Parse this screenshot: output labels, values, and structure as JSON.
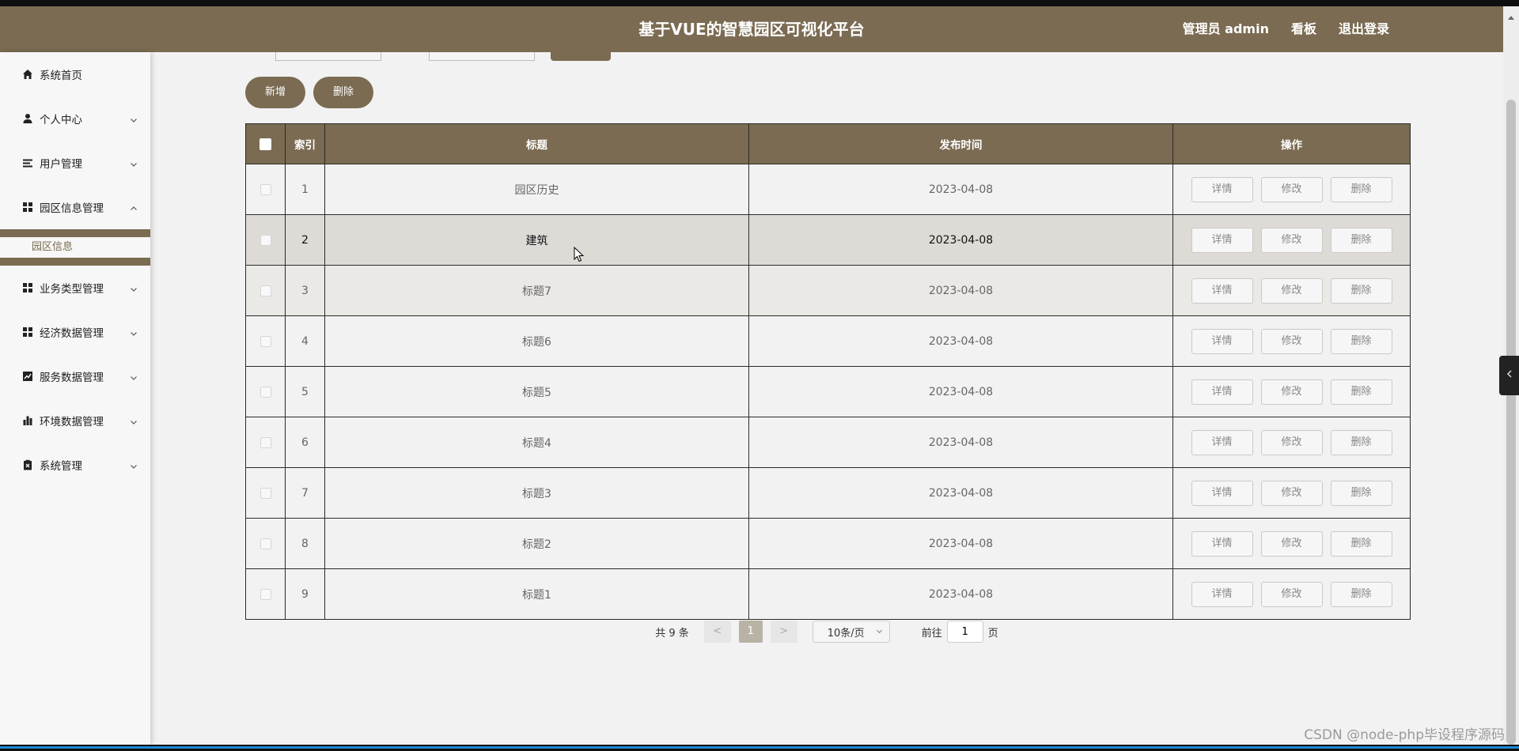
{
  "header": {
    "title": "基于VUE的智慧园区可视化平台",
    "user": "管理员 admin",
    "dashboard": "看板",
    "logout": "退出登录"
  },
  "sidebar": {
    "items": [
      {
        "label": "系统首页",
        "icon": "home-icon",
        "expandable": false
      },
      {
        "label": "个人中心",
        "icon": "user-icon",
        "expandable": true
      },
      {
        "label": "用户管理",
        "icon": "list-icon",
        "expandable": true
      },
      {
        "label": "园区信息管理",
        "icon": "grid-icon",
        "expandable": true,
        "expanded": true,
        "children": [
          "园区信息"
        ]
      },
      {
        "label": "业务类型管理",
        "icon": "grid-icon",
        "expandable": true
      },
      {
        "label": "经济数据管理",
        "icon": "grid-icon",
        "expandable": true
      },
      {
        "label": "服务数据管理",
        "icon": "line-chart-icon",
        "expandable": true
      },
      {
        "label": "环境数据管理",
        "icon": "bar-chart-icon",
        "expandable": true
      },
      {
        "label": "系统管理",
        "icon": "clipboard-icon",
        "expandable": true
      }
    ]
  },
  "toolbar": {
    "add_label": "新增",
    "delete_label": "删除"
  },
  "table": {
    "columns": [
      "索引",
      "标题",
      "发布时间",
      "操作"
    ],
    "actions": [
      "详情",
      "修改",
      "删除"
    ],
    "rows": [
      {
        "index": "1",
        "title": "园区历史",
        "date": "2023-04-08"
      },
      {
        "index": "2",
        "title": "建筑",
        "date": "2023-04-08"
      },
      {
        "index": "3",
        "title": "标题7",
        "date": "2023-04-08"
      },
      {
        "index": "4",
        "title": "标题6",
        "date": "2023-04-08"
      },
      {
        "index": "5",
        "title": "标题5",
        "date": "2023-04-08"
      },
      {
        "index": "6",
        "title": "标题4",
        "date": "2023-04-08"
      },
      {
        "index": "7",
        "title": "标题3",
        "date": "2023-04-08"
      },
      {
        "index": "8",
        "title": "标题2",
        "date": "2023-04-08"
      },
      {
        "index": "9",
        "title": "标题1",
        "date": "2023-04-08"
      }
    ]
  },
  "pager": {
    "total": "共 9 条",
    "prev": "<",
    "page": "1",
    "next": ">",
    "size": "10条/页",
    "goto_prefix": "前往",
    "goto_value": "1",
    "goto_suffix": "页"
  },
  "watermark": "CSDN @node-php毕设程序源码",
  "colors": {
    "brand": "#7a6b52",
    "background": "#f2f2f2",
    "hover_row": "#dedbd7"
  }
}
